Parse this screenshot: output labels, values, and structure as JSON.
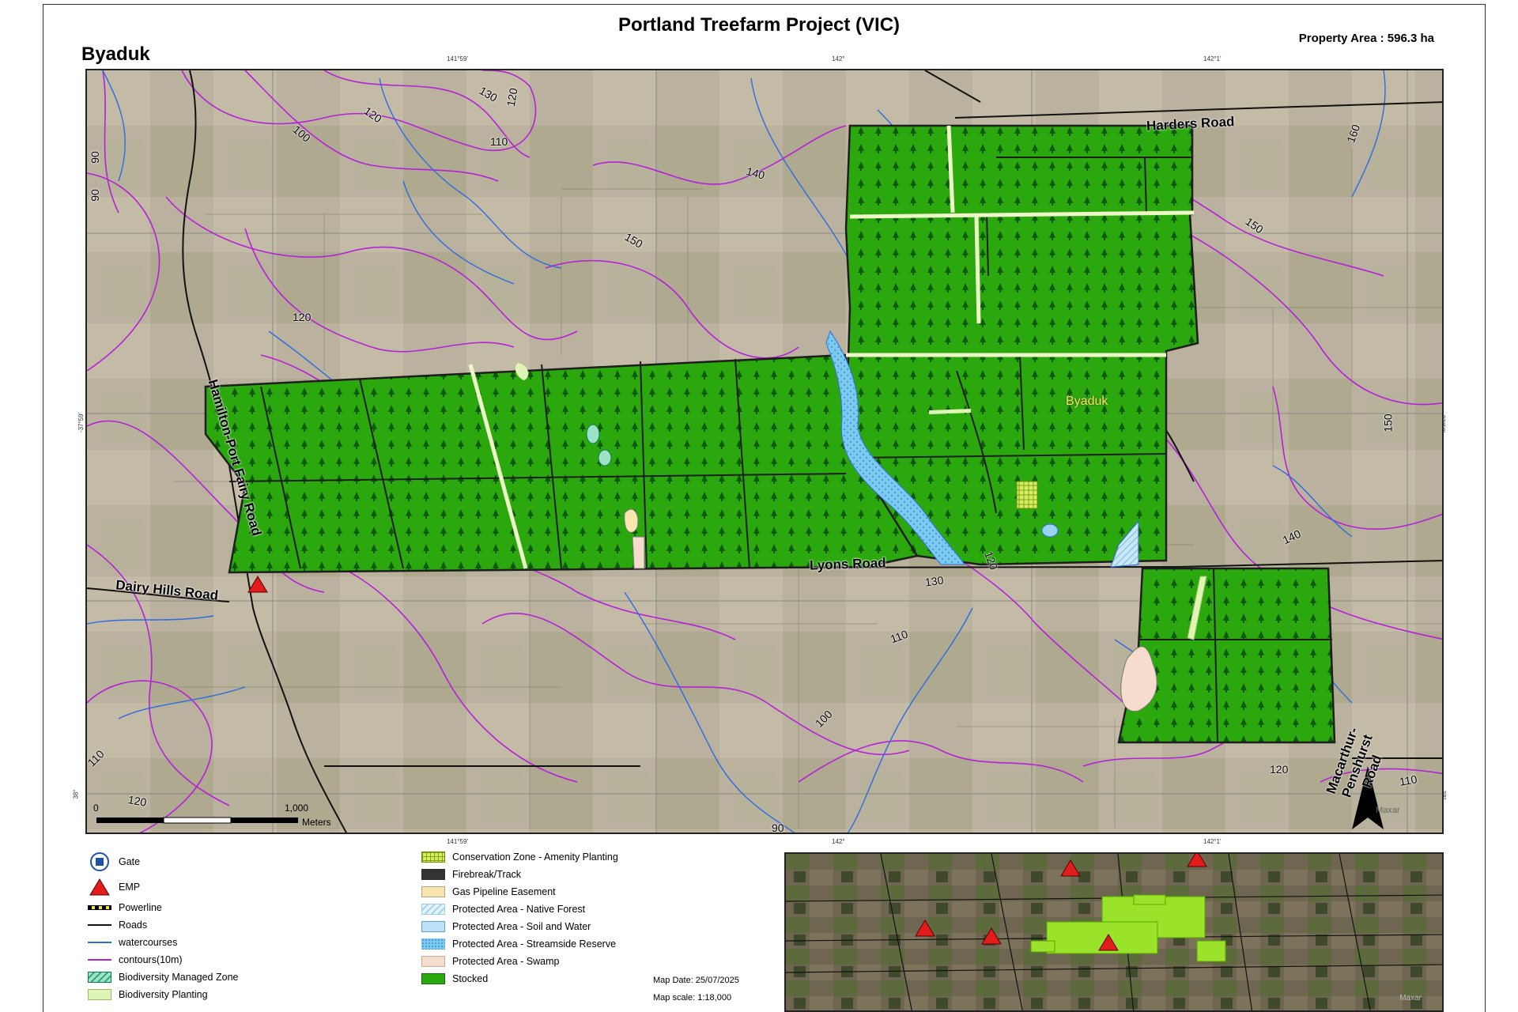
{
  "title": "Portland Treefarm Project (VIC)",
  "property_area": "Property Area : 596.3 ha",
  "subtitle": "Byaduk",
  "map": {
    "roads": [
      "Harders Road",
      "Hamilton-Port Fairy Road",
      "Dairy Hills Road",
      "Lyons Road",
      "Macarthur-Penshurst Road"
    ],
    "place_label": "Byaduk",
    "contour_labels": [
      "130",
      "120",
      "120",
      "110",
      "100",
      "90",
      "90",
      "140",
      "150",
      "120",
      "150",
      "160",
      "150",
      "140",
      "130",
      "120",
      "110",
      "100",
      "110",
      "120",
      "90",
      "120",
      "110"
    ],
    "graticule": {
      "top": [
        "141°59'",
        "142°",
        "142°1'"
      ],
      "bottom": [
        "141°59'",
        "142°",
        "142°1'"
      ],
      "left": [
        "-37°59'",
        "38°"
      ],
      "right": [
        "-37°59'",
        "-38°"
      ]
    },
    "scale_bar": {
      "start": "0",
      "end": "1,000",
      "unit": "Meters"
    },
    "attribution": "Maxar"
  },
  "legend": {
    "left_column": [
      {
        "label": "Gate",
        "icon": "gate-icon"
      },
      {
        "label": "EMP",
        "icon": "emp-triangle-icon"
      },
      {
        "label": "Powerline",
        "icon": "powerline-icon"
      },
      {
        "label": "Roads",
        "icon": "road-line-icon"
      },
      {
        "label": "watercourses",
        "icon": "watercourse-line-icon"
      },
      {
        "label": "contours(10m)",
        "icon": "contour-line-icon"
      },
      {
        "label": "Biodiversity Managed Zone",
        "icon": "biodiversity-managed-swatch"
      },
      {
        "label": "Biodiversity Planting",
        "icon": "biodiversity-planting-swatch"
      }
    ],
    "middle_column": [
      {
        "label": "Conservation Zone - Amenity Planting",
        "icon": "conservation-swatch"
      },
      {
        "label": "Firebreak/Track",
        "icon": "firebreak-swatch"
      },
      {
        "label": "Gas Pipeline Easement",
        "icon": "gas-pipeline-swatch"
      },
      {
        "label": "Protected Area - Native Forest",
        "icon": "native-forest-swatch"
      },
      {
        "label": "Protected Area - Soil and Water",
        "icon": "soil-water-swatch"
      },
      {
        "label": "Protected Area - Streamside Reserve",
        "icon": "streamside-swatch"
      },
      {
        "label": "Protected Area - Swamp",
        "icon": "swamp-swatch"
      },
      {
        "label": "Stocked",
        "icon": "stocked-swatch"
      }
    ]
  },
  "map_date": "Map Date: 25/07/2025",
  "map_scale": "Map scale: 1:18,000",
  "inset": {
    "attribution": "Maxar"
  },
  "colors": {
    "stocked": "#2ca80f",
    "contour": "#b620d8",
    "watercourse": "#2f6be0",
    "road": "#111111",
    "emp": "#e21b1b",
    "streamside": "#7cc9f0",
    "swamp": "#f6dccc",
    "gas_pipeline": "#f8e6b0",
    "inset_plantation": "#9be22a"
  }
}
